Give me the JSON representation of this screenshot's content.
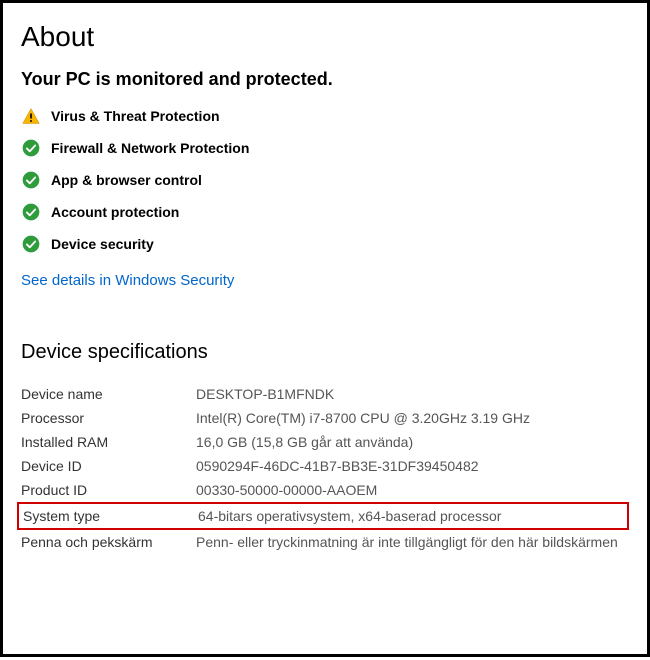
{
  "header": {
    "title": "About",
    "subhead": "Your PC is monitored and protected."
  },
  "status_items": [
    {
      "icon": "warning",
      "label": "Virus & Threat Protection"
    },
    {
      "icon": "check",
      "label": "Firewall & Network Protection"
    },
    {
      "icon": "check",
      "label": "App & browser control"
    },
    {
      "icon": "check",
      "label": "Account protection"
    },
    {
      "icon": "check",
      "label": "Device security"
    }
  ],
  "security_link": "See details in Windows Security",
  "specs": {
    "section_title": "Device specifications",
    "rows": [
      {
        "label": "Device name",
        "value": "DESKTOP-B1MFNDK"
      },
      {
        "label": "Processor",
        "value": "Intel(R) Core(TM) i7-8700 CPU @ 3.20GHz 3.19 GHz"
      },
      {
        "label": "Installed RAM",
        "value": "16,0 GB (15,8 GB går att använda)"
      },
      {
        "label": "Device ID",
        "value": "0590294F-46DC-41B7-BB3E-31DF39450482"
      },
      {
        "label": "Product ID",
        "value": "00330-50000-00000-AAOEM"
      },
      {
        "label": "System type",
        "value": "64-bitars operativsystem, x64-baserad processor",
        "highlight": true
      },
      {
        "label": "Penna och pekskärm",
        "value": "Penn- eller tryckinmatning är inte tillgängligt för den här bildskärmen"
      }
    ]
  }
}
